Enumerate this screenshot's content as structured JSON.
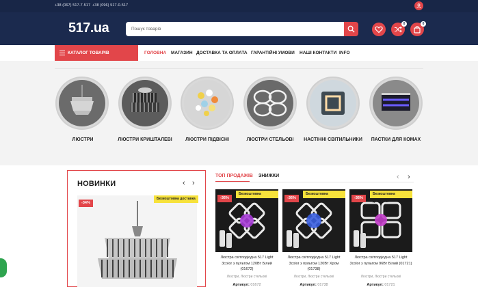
{
  "header": {
    "phones": [
      "+38 (067) 517-7-517",
      "+38 (096) 517-0-517"
    ],
    "logo": "517.ua",
    "search_placeholder": "Пошук товарів",
    "wishlist_count": "0",
    "compare_count": "0",
    "cart_count": "0"
  },
  "nav": {
    "catalog_label": "КАТАЛОГ ТОВАРІВ",
    "items": [
      "ГОЛОВНА",
      "МАГАЗИН",
      "ДОСТАВКА ТА ОПЛАТА",
      "ГАРАНТІЙНІ УМОВИ",
      "НАШІ КОНТАКТИ",
      "INFO"
    ]
  },
  "categories": [
    {
      "label": "ЛЮСТРИ",
      "icon": "chandelier-photo"
    },
    {
      "label": "ЛЮСТРИ КРИШТАЛЕВІ",
      "icon": "crystal-chandelier-photo"
    },
    {
      "label": "ЛЮСТРИ ПІДВІСНІ",
      "icon": "pendant-chandelier-photo"
    },
    {
      "label": "ЛЮСТРИ СТЕЛЬОВІ",
      "icon": "ceiling-chandelier-photo"
    },
    {
      "label": "НАСТІННІ СВІТИЛЬНИКИ",
      "icon": "wall-lamp-photo"
    },
    {
      "label": "ПАСТКИ ДЛЯ КОМАХ",
      "icon": "insect-trap-photo"
    }
  ],
  "novinky": {
    "title": "НОВИНКИ",
    "discount": "-34%",
    "free_delivery": "Безкоштовна доставка"
  },
  "tabs": [
    "ТОП ПРОДАЖІВ",
    "ЗНИЖКИ"
  ],
  "products": [
    {
      "discount": "-36%",
      "free_delivery": "Безкоштовна доставка",
      "name": "Люстра світлодіодна 517 Light 3color з пультом 120Вт Білий (01672)",
      "category": "Люстри, Люстри стельові",
      "article_label": "Артикул:",
      "article": "01672"
    },
    {
      "discount": "-36%",
      "free_delivery": "Безкоштовна доставка",
      "name": "Люстра світлодіодна 517 Light 3color з пультом 120Вт Хром (01738)",
      "category": "Люстри, Люстри стельові",
      "article_label": "Артикул:",
      "article": "01738"
    },
    {
      "discount": "-36%",
      "free_delivery": "Безкоштовна доставка",
      "name": "Люстра світлодіодна 517 Light 3color з пультом 96Вт Білий (01721)",
      "category": "Люстри, Люстри стельові",
      "article_label": "Артикул:",
      "article": "01721"
    }
  ],
  "colors": {
    "header": "#1b2a4e",
    "accent": "#e2464a",
    "badge_yellow": "#f7e23b"
  }
}
